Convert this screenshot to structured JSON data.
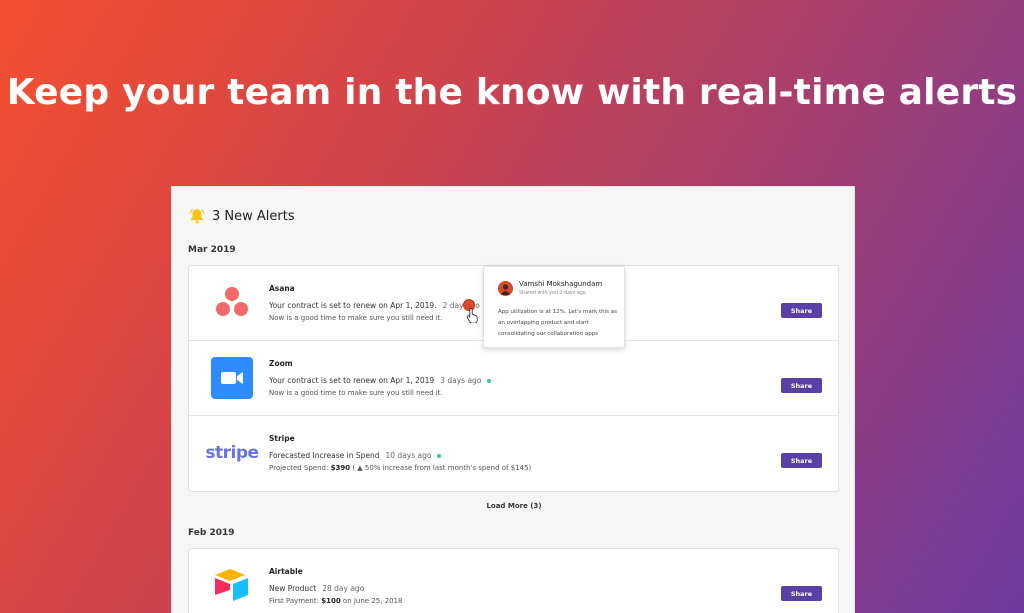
{
  "headline": "Keep your team in the know with real-time alerts",
  "panel": {
    "title": "3 New Alerts",
    "groups": [
      {
        "label": "Mar 2019",
        "alerts": [
          {
            "app": "Asana",
            "line1": "Your contract is set to renew on Apr 1, 2019.",
            "ago": "2 day ago",
            "line2": "Now is a good time to make sure you still need it.",
            "share": "Share"
          },
          {
            "app": "Zoom",
            "line1": "Your contract is set to renew on Apr 1, 2019",
            "ago": "3 days ago",
            "line2": "Now is a good time to make sure you still need it.",
            "share": "Share"
          },
          {
            "app": "Stripe",
            "logo_text": "stripe",
            "line1": "Forecasted Increase in Spend",
            "ago": "10 days ago",
            "line2_prefix": "Projected Spend:",
            "line2_amount": "$390",
            "line2_suffix": "( ▲ 50% increase from last month's spend of $145)",
            "share": "Share"
          }
        ]
      },
      {
        "label": "Feb 2019",
        "alerts": [
          {
            "app": "Airtable",
            "line1": "New Product",
            "ago": "28 day ago",
            "line2_prefix": "First Payment:",
            "line2_amount": "$100",
            "line2_suffix": "on June 25, 2018",
            "share": "Share"
          }
        ]
      }
    ],
    "load_more": "Load More (3)"
  },
  "popup": {
    "name": "Vamshi Mokshagundam",
    "meta": "Shared with you 2 days ago",
    "message": "App utilization is at 12%. Let's mark this as an overlapping product and start consolidating our collaboration apps"
  },
  "colors": {
    "accent": "#5a3fa6",
    "status_dot": "#2fcf9a",
    "bell": "#f7c619"
  }
}
